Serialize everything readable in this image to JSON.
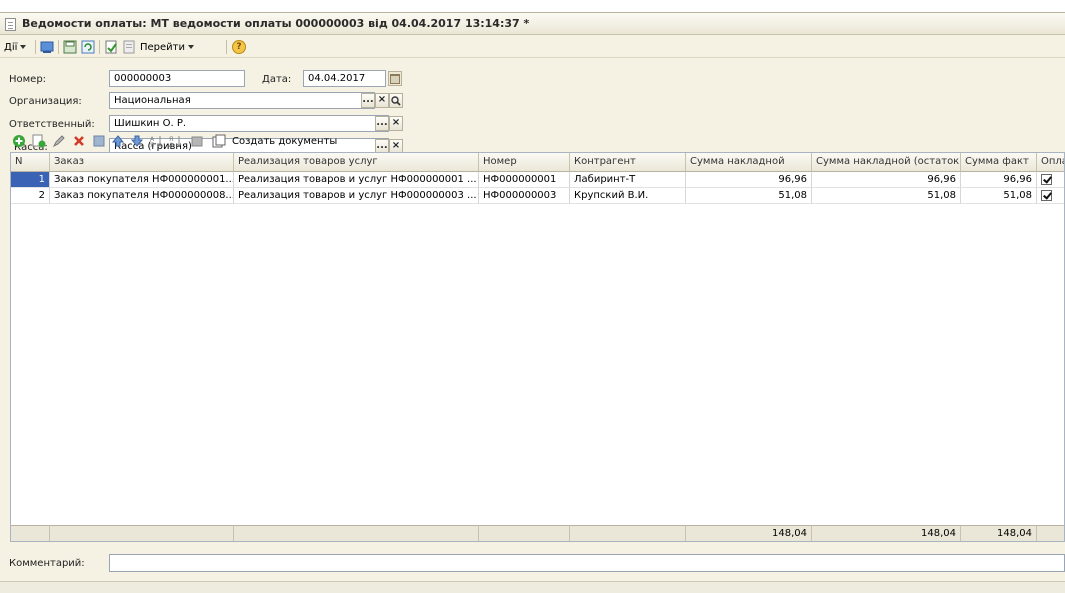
{
  "window": {
    "title": "Ведомости оплаты: МТ ведомости оплаты 000000003 від 04.04.2017 13:14:37 *"
  },
  "toolbar": {
    "actions_label": "Дії",
    "goto_label": "Перейти",
    "help_icon": "?"
  },
  "form": {
    "number_label": "Номер:",
    "number_value": "000000003",
    "date_label": "Дата:",
    "date_value": "04.04.2017",
    "org_label": "Организация:",
    "org_value": "Национальная",
    "resp_label": "Ответственный:",
    "resp_value": "Шишкин О. Р.",
    "cash_label": "Касса:",
    "cash_value": "Касса (гривня)",
    "dots": "...",
    "clear": "×",
    "search": "🔍"
  },
  "table_toolbar": {
    "create_docs_label": "Создать документы"
  },
  "table": {
    "columns": [
      "N",
      "Заказ",
      "Реализация товаров услуг",
      "Номер",
      "Контрагент",
      "Сумма накладной",
      "Сумма накладной (остаток)",
      "Сумма факт",
      "Опла"
    ],
    "rows": [
      {
        "n": "1",
        "order": "Заказ покупателя НФ000000001...",
        "realization": "Реализация товаров и услуг НФ000000001 ...",
        "number": "НФ000000001",
        "contractor": "Лабиринт-Т",
        "sum": "96,96",
        "sum_rest": "96,96",
        "sum_fact": "96,96",
        "paid": true
      },
      {
        "n": "2",
        "order": "Заказ покупателя НФ000000008...",
        "realization": "Реализация товаров и услуг НФ000000003 ...",
        "number": "НФ000000003",
        "contractor": "Крупский В.И.",
        "sum": "51,08",
        "sum_rest": "51,08",
        "sum_fact": "51,08",
        "paid": true
      }
    ],
    "totals": {
      "sum": "148,04",
      "sum_rest": "148,04",
      "sum_fact": "148,04"
    }
  },
  "comment": {
    "label": "Комментарий:",
    "value": ""
  },
  "colors": {
    "selection": "#3a63b5",
    "panel": "#f5f2e4"
  }
}
